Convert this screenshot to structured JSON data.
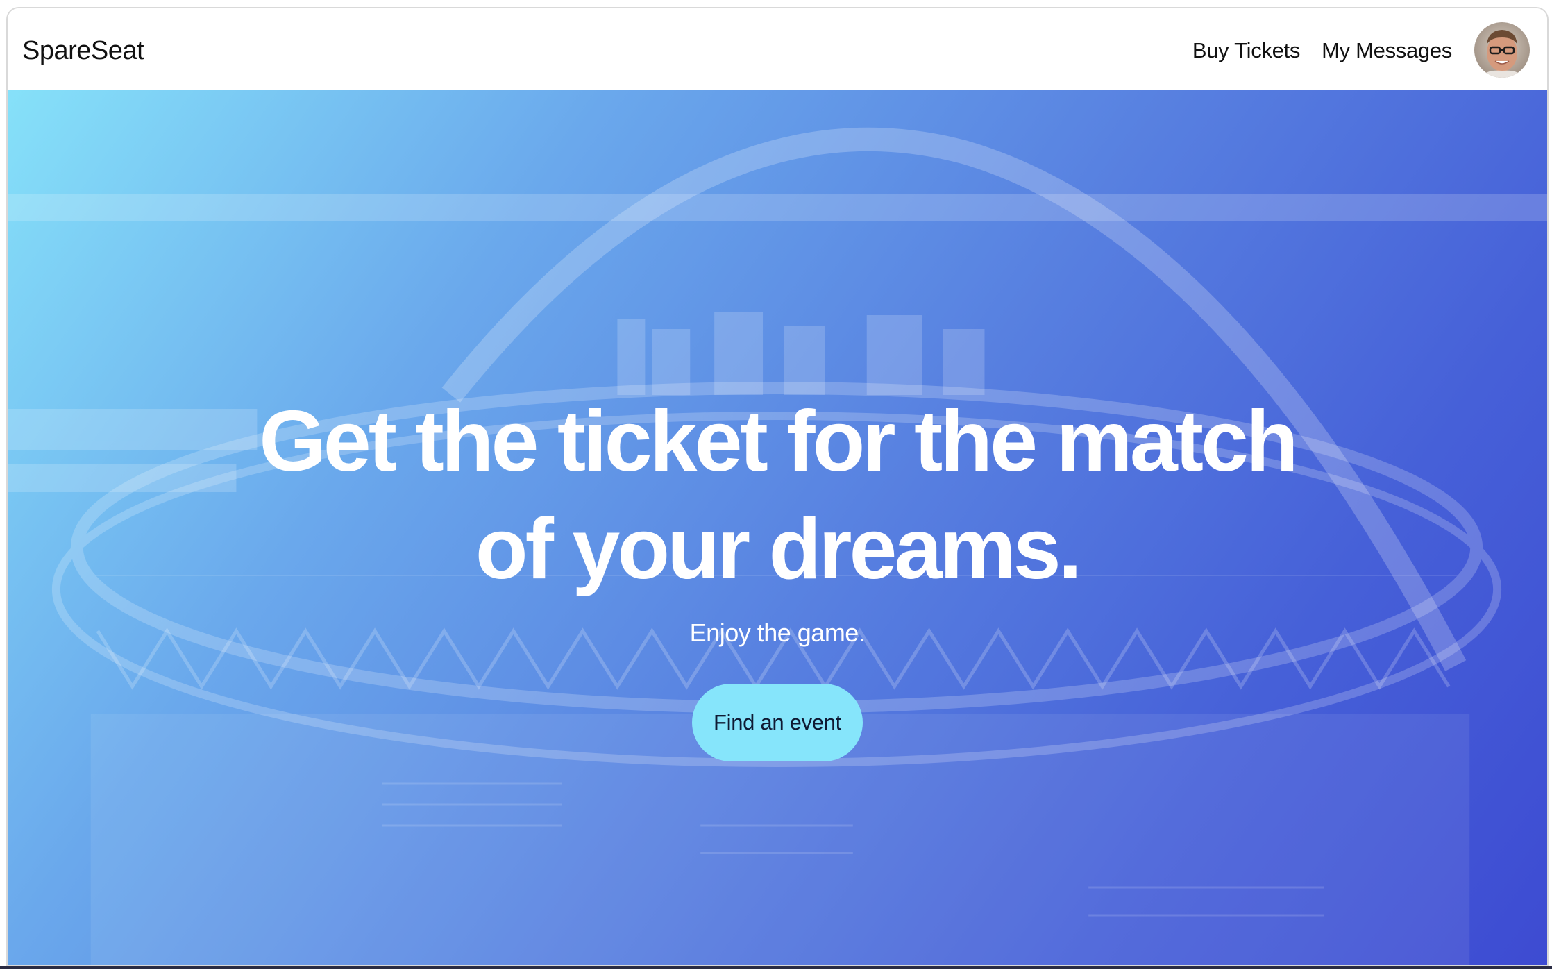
{
  "navbar": {
    "brand": "SpareSeat",
    "links": [
      {
        "label": "Buy Tickets"
      },
      {
        "label": "My Messages"
      }
    ],
    "avatar_icon": "user-avatar-icon"
  },
  "hero": {
    "headline_line1": "Get the ticket for the match",
    "headline_line2": "of your dreams.",
    "subtitle": "Enjoy the game.",
    "cta_label": "Find an event",
    "background_icon": "stadium-image",
    "colors": {
      "gradient_start": "#86e1f9",
      "gradient_end": "#3d4bd2",
      "cta_background": "#86e5fb",
      "headline": "#ffffff"
    }
  }
}
